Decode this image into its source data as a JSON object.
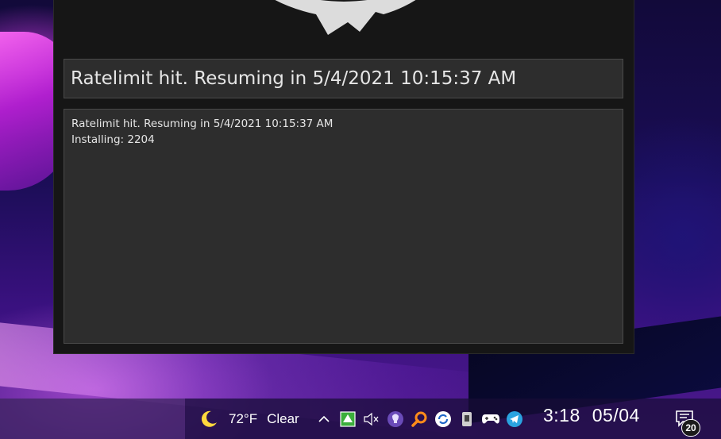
{
  "app": {
    "status_text": "Ratelimit hit. Resuming in 5/4/2021 10:15:37 AM",
    "log_lines": [
      "Ratelimit hit. Resuming in 5/4/2021 10:15:37 AM",
      "Installing: 2204"
    ]
  },
  "taskbar": {
    "weather": {
      "icon": "moon-icon",
      "temperature": "72°F",
      "condition": "Clear"
    },
    "tray_icons": [
      "chevron-up-icon",
      "green-up-arrow-icon",
      "speaker-muted-icon",
      "lightbulb-icon",
      "magnifier-icon",
      "sync-icon",
      "device-icon",
      "gamepad-icon",
      "telegram-icon"
    ],
    "clock": {
      "time": "3:18",
      "date": "05/04"
    },
    "notifications": {
      "count": "20"
    }
  }
}
